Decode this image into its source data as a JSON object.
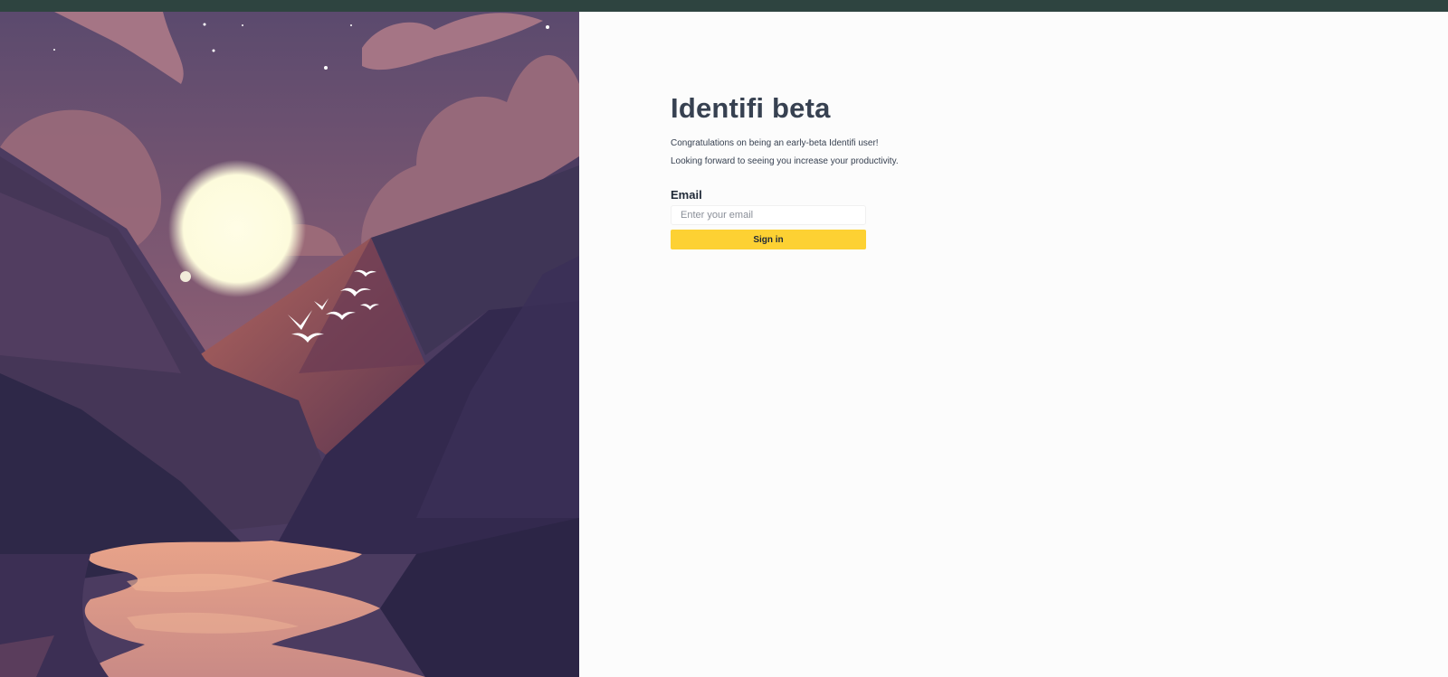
{
  "header": {
    "bar_color": "#2e4440"
  },
  "hero": {
    "image": "night-mountain-lake-illustration-with-moon-and-birds"
  },
  "login": {
    "title": "Identifi beta",
    "line1": "Congratulations on being an early-beta Identifi user!",
    "line2": "Looking forward to seeing you increase your productivity.",
    "email_label": "Email",
    "email_placeholder": "Enter your email",
    "email_value": "",
    "signin_label": "Sign in",
    "accent": "#fdd133"
  }
}
